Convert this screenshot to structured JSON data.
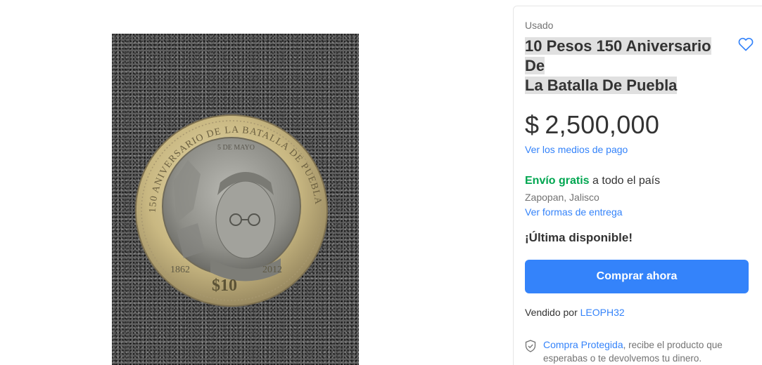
{
  "product": {
    "condition": "Usado",
    "title_line1": "10 Pesos 150 Aniversario De",
    "title_line2": "La Batalla De Puebla",
    "currency": "$",
    "price": "2,500,000",
    "payment_link": "Ver los medios de pago",
    "shipping_free": "Envío gratis",
    "shipping_scope": " a todo el país",
    "location": "Zapopan, Jalisco",
    "delivery_link": "Ver formas de entrega",
    "stock": "¡Última disponible!",
    "buy_label": "Comprar ahora",
    "seller_prefix": "Vendido por ",
    "seller_name": "LEOPH32",
    "protection_link": "Compra Protegida",
    "protection_text": ", recibe el producto que esperabas o te devolvemos tu dinero."
  },
  "coin": {
    "ring_text": "150 ANIVERSARIO DE LA BATALLA DE PUEBLA",
    "date_text": "5 DE MAYO",
    "year_left": "1862",
    "year_right": "2012",
    "denomination": "$10"
  },
  "icons": {
    "favorite": "heart-outline-icon",
    "protection": "shield-check-icon"
  },
  "colors": {
    "accent": "#3483fa",
    "free_shipping": "#00a650"
  }
}
